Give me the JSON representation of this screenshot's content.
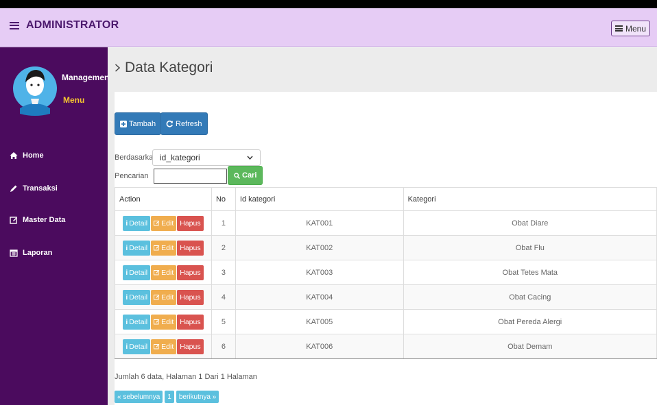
{
  "header": {
    "title": "ADMINISTRATOR",
    "menu_button": "Menu"
  },
  "sidebar": {
    "profile_name": "Management",
    "profile_sub": "Menu",
    "items": [
      {
        "label": "Home",
        "icon": "home-icon"
      },
      {
        "label": "Transaksi",
        "icon": "pencil-icon"
      },
      {
        "label": "Master Data",
        "icon": "edit-icon"
      },
      {
        "label": "Laporan",
        "icon": "calendar-icon"
      }
    ]
  },
  "main": {
    "page_title": "Data Kategori",
    "buttons": {
      "tambah": "Tambah",
      "refresh": "Refresh",
      "cari": "Cari"
    },
    "filter": {
      "label": "Berdasarkan:",
      "selected": "id_kategori",
      "search_label": "Pencarian",
      "search_sep": ":",
      "search_value": ""
    },
    "table": {
      "columns": [
        "Action",
        "No",
        "Id kategori",
        "Kategori"
      ],
      "action_labels": {
        "detail": "Detail",
        "edit": "Edit",
        "hapus": "Hapus"
      },
      "rows": [
        {
          "no": "1",
          "id": "KAT001",
          "kategori": "Obat Diare"
        },
        {
          "no": "2",
          "id": "KAT002",
          "kategori": "Obat Flu"
        },
        {
          "no": "3",
          "id": "KAT003",
          "kategori": "Obat Tetes Mata"
        },
        {
          "no": "4",
          "id": "KAT004",
          "kategori": "Obat Cacing"
        },
        {
          "no": "5",
          "id": "KAT005",
          "kategori": "Obat Pereda Alergi"
        },
        {
          "no": "6",
          "id": "KAT006",
          "kategori": "Obat Demam"
        }
      ]
    },
    "summary": "Jumlah 6 data, Halaman 1 Dari 1 Halaman",
    "pagination": {
      "prev": "« sebelumnya",
      "page": "1",
      "next": "berikutnya »"
    }
  },
  "colors": {
    "topbar": "#e6ccf5",
    "sidebar": "#4b0b5e",
    "brand_text": "#4d1a6e",
    "primary": "#337ab7",
    "success": "#5cb85c",
    "info": "#5bc0de",
    "warning": "#f0ad4e",
    "danger": "#d9534f"
  }
}
